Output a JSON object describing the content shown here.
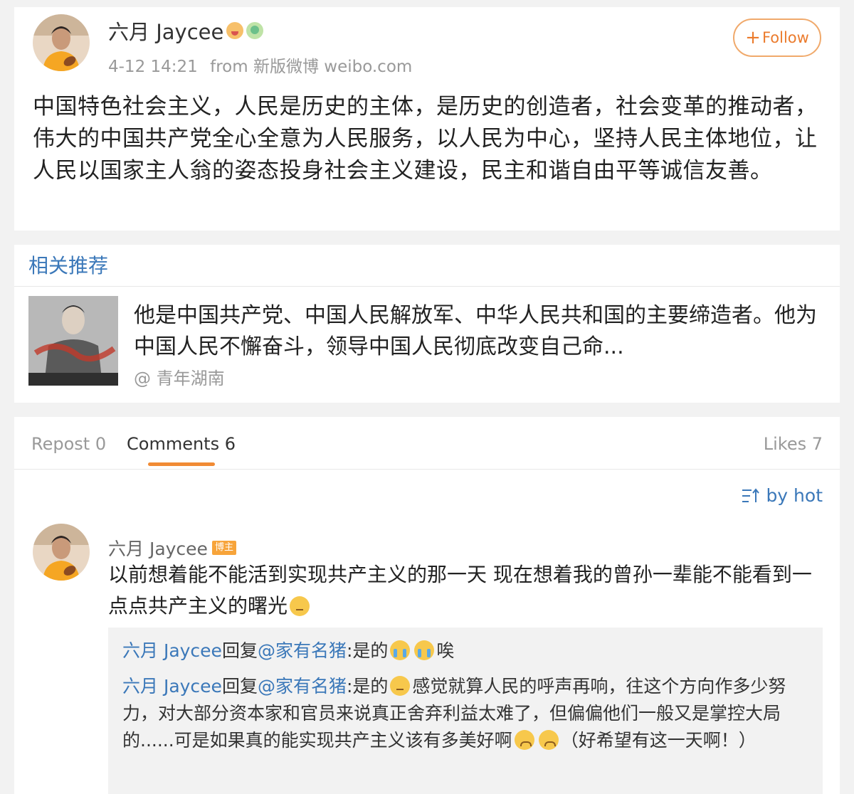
{
  "post": {
    "author": "六月 Jaycee",
    "time": "4-12 14:21",
    "source": "from 新版微博 weibo.com",
    "follow_label": "Follow",
    "follow_icon": "+",
    "text": "中国特色社会主义，人民是历史的主体，是历史的创造者，社会变革的推动者，伟大的中国共产党全心全意为人民服务，以人民为中心，坚持人民主体地位，让人民以国家主人翁的姿态投身社会主义建设，民主和谐自由平等诚信友善。"
  },
  "related": {
    "header": "相关推荐",
    "title": "他是中国共产党、中国人民解放军、中华人民共和国的主要缔造者。他为中国人民不懈奋斗，领导中国人民彻底改变自己命...",
    "source": "@ 青年湖南"
  },
  "tabs": {
    "repost": "Repost 0",
    "comments": "Comments 6",
    "likes": "Likes 7"
  },
  "sort_label": "by hot",
  "comment": {
    "author": "六月 Jaycee",
    "badge": "博主",
    "text": "以前想着能不能活到实现共产主义的那一天 现在想着我的曾孙一辈能不能看到一点点共产主义的曙光",
    "replies": [
      {
        "name": "六月 Jaycee",
        "verb": "回复",
        "mention": "@家有名猪",
        "text_a": ":是的",
        "text_b": "唉"
      },
      {
        "name": "六月 Jaycee",
        "verb": "回复",
        "mention": "@家有名猪",
        "text_a": ":是的",
        "text_b": "感觉就算人民的呼声再响，往这个方向作多少努力，对大部分资本家和官员来说真正舍弃利益太难了，但偏偏他们一般又是掌控大局的......可是如果真的能实现共产主义该有多美好啊",
        "text_c": "（好希望有这一天啊！）"
      }
    ]
  },
  "colors": {
    "link": "#3b78b9",
    "accent": "#f18b34",
    "follow": "#eb7b2d",
    "meta": "#999999",
    "background": "#f2f2f2"
  }
}
